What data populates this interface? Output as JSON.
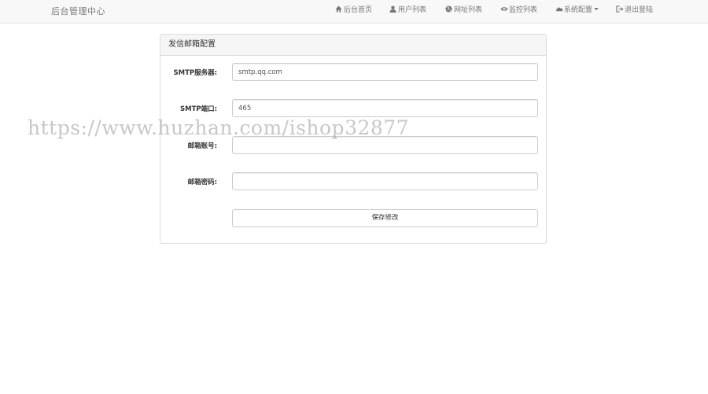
{
  "brand": "后台管理中心",
  "nav": {
    "home": "后台首页",
    "users": "用户列表",
    "urls": "网址列表",
    "monitor": "监控列表",
    "settings": "系统配置",
    "logout": "退出登陆"
  },
  "panel": {
    "title": "发信邮箱配置",
    "fields": {
      "smtp_server": {
        "label": "SMTP服务器:",
        "value": "smtp.qq.com"
      },
      "smtp_port": {
        "label": "SMTP端口:",
        "value": "465"
      },
      "email_account": {
        "label": "邮箱账号:",
        "value": ""
      },
      "email_password": {
        "label": "邮箱密码:",
        "value": ""
      }
    },
    "save_label": "保存修改"
  },
  "watermark": "https://www.huzhan.com/ishop32877"
}
